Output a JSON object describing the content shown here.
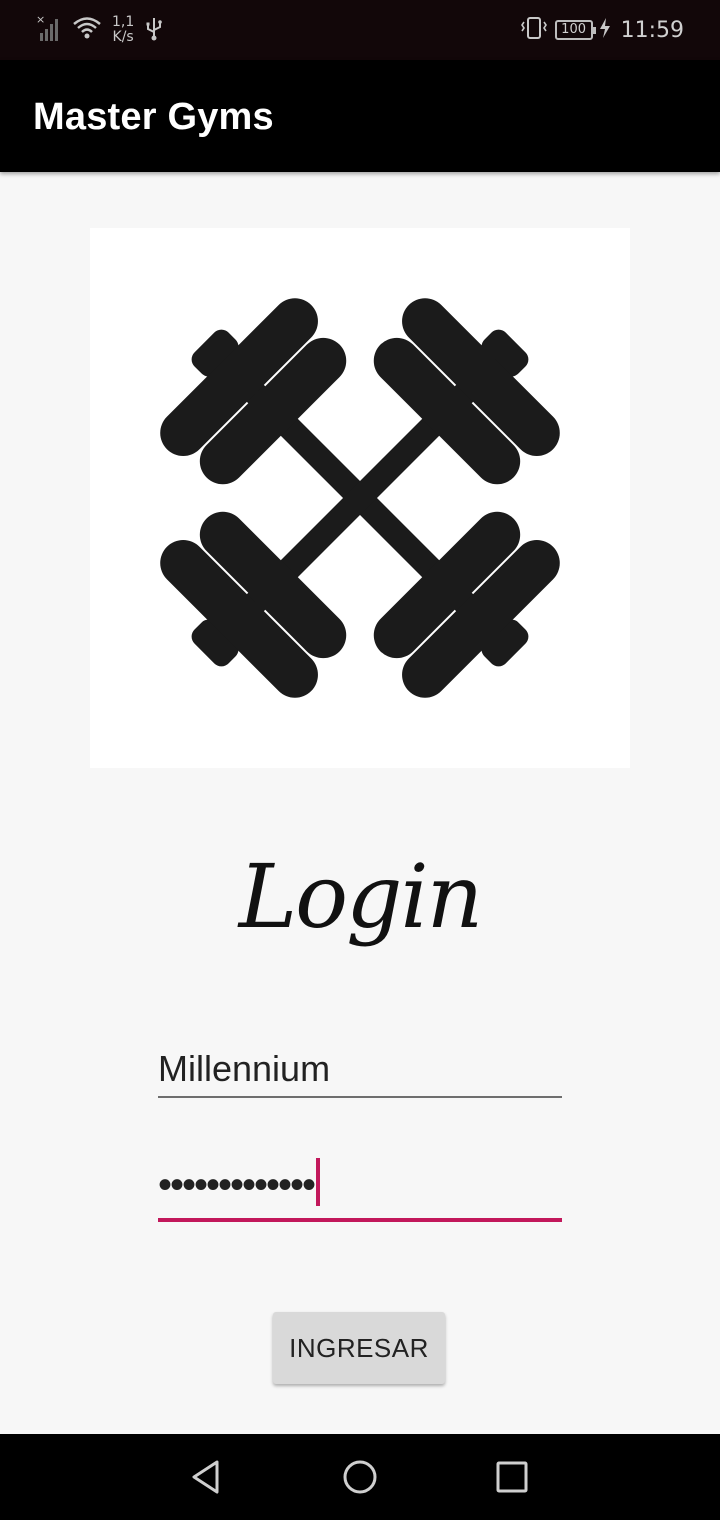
{
  "status_bar": {
    "speed_value": "1,1",
    "speed_unit": "K/s",
    "battery": "100",
    "time": "11:59",
    "icons": [
      "no-signal-icon",
      "wifi-icon",
      "usb-icon",
      "vibrate-icon",
      "battery-icon",
      "charging-icon"
    ]
  },
  "app_bar": {
    "title": "Master Gyms",
    "background": "#000000"
  },
  "logo": {
    "icon": "crossed-dumbbells-icon"
  },
  "login": {
    "heading": "Login",
    "username_value": "Millennium",
    "password_value": "•••••••••••••",
    "accent_color": "#c2185b",
    "submit_label": "INGRESAR"
  },
  "nav_bar": {
    "icons": [
      "back-icon",
      "home-icon",
      "recents-icon"
    ]
  }
}
